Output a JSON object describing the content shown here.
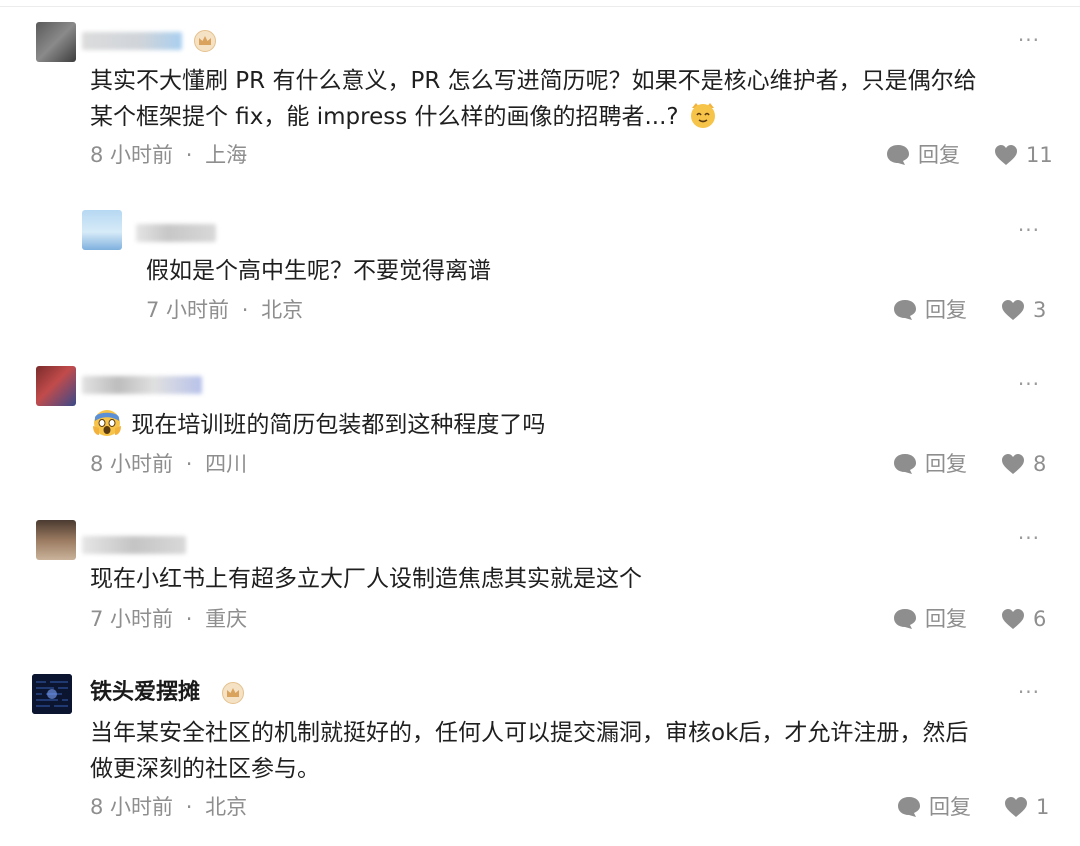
{
  "comments": [
    {
      "line1": "其实不大懂刷 PR 有什么意义，PR 怎么写进简历呢？如果不是核心维护者，只是偶尔给",
      "line2": "某个框架提个 fix，能 impress 什么样的画像的招聘者...?",
      "time": "8 小时前",
      "location": "上海",
      "reply_label": "回复",
      "likes": "11"
    },
    {
      "line1": "假如是个高中生呢？不要觉得离谱",
      "time": "7 小时前",
      "location": "北京",
      "reply_label": "回复",
      "likes": "3"
    },
    {
      "line1": "现在培训班的简历包装都到这种程度了吗",
      "time": "8 小时前",
      "location": "四川",
      "reply_label": "回复",
      "likes": "8"
    },
    {
      "line1": "现在小红书上有超多立大厂人设制造焦虑其实就是这个",
      "time": "7 小时前",
      "location": "重庆",
      "reply_label": "回复",
      "likes": "6"
    },
    {
      "username": "铁头爱摆摊",
      "line1": "当年某安全社区的机制就挺好的，任何人可以提交漏洞，审核ok后，才允许注册，然后",
      "line2": "做更深刻的社区参与。",
      "time": "8 小时前",
      "location": "北京",
      "reply_label": "回复",
      "likes": "1"
    }
  ],
  "separator": "·",
  "more_label": "···",
  "icons": {
    "reply": "comment-bubble-icon",
    "like": "heart-icon",
    "more": "more-dots-icon",
    "badge": "crown-badge-icon",
    "emoji_cat": "cat-face-emoji-icon",
    "emoji_scream": "screaming-face-emoji-icon"
  },
  "colors": {
    "text": "#1f1f1f",
    "meta": "#8e8e8e",
    "badge": "#e5c18d"
  }
}
